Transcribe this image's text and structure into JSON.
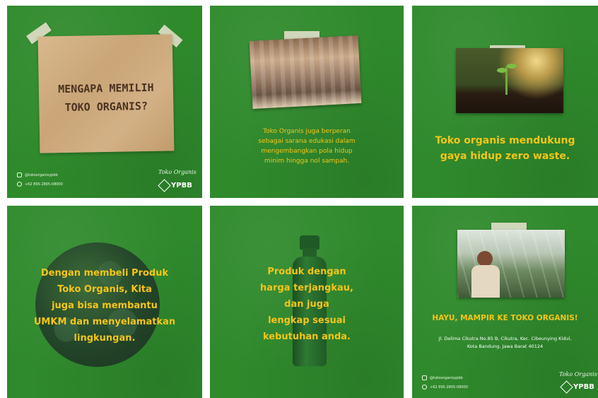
{
  "tiles": {
    "t1": {
      "heading_line1": "MENGAPA MEMILIH",
      "heading_line2": "TOKO ORGANIS?",
      "instagram": "@tokoorganisypbb",
      "whatsapp": "+62 895-2805-08000",
      "brand_script": "Toko Organis",
      "brand_logo": "YPBB"
    },
    "t2": {
      "lines": [
        "Toko Organis juga berperan",
        "sebagai sarana edukasi dalam",
        "mengembangkan pola hidup",
        "minim hingga nol sampah."
      ]
    },
    "t3": {
      "lines": [
        "Toko organis mendukung",
        "gaya hidup zero waste."
      ]
    },
    "t4": {
      "lines": [
        "Dengan membeli Produk",
        "Toko Organis, Kita",
        "juga bisa membantu",
        "UMKM dan menyelamatkan",
        "lingkungan."
      ]
    },
    "t5": {
      "lines": [
        "Produk dengan",
        "harga terjangkau,",
        "dan juga",
        "lengkap sesuai",
        "kebutuhan anda."
      ]
    },
    "t6": {
      "heading": "HAYU, MAMPIR KE TOKO ORGANIS!",
      "address_line1": "Jl. Delima Cikutra No.85 B, Cikutra, Kec. Cibeunying Kidul,",
      "address_line2": "Kota Bandung, Jawa Barat 40124",
      "instagram": "@tokoorganisypbb",
      "whatsapp": "+62 895-2805-08000",
      "brand_script": "Toko Organis",
      "brand_logo": "YPBB"
    }
  },
  "colors": {
    "tile_green": "#2f8a2c",
    "text_yellow": "#f5c518",
    "paper": "#d3b186"
  },
  "icons": [
    "instagram-icon",
    "whatsapp-icon",
    "ypbb-cube-icon"
  ]
}
